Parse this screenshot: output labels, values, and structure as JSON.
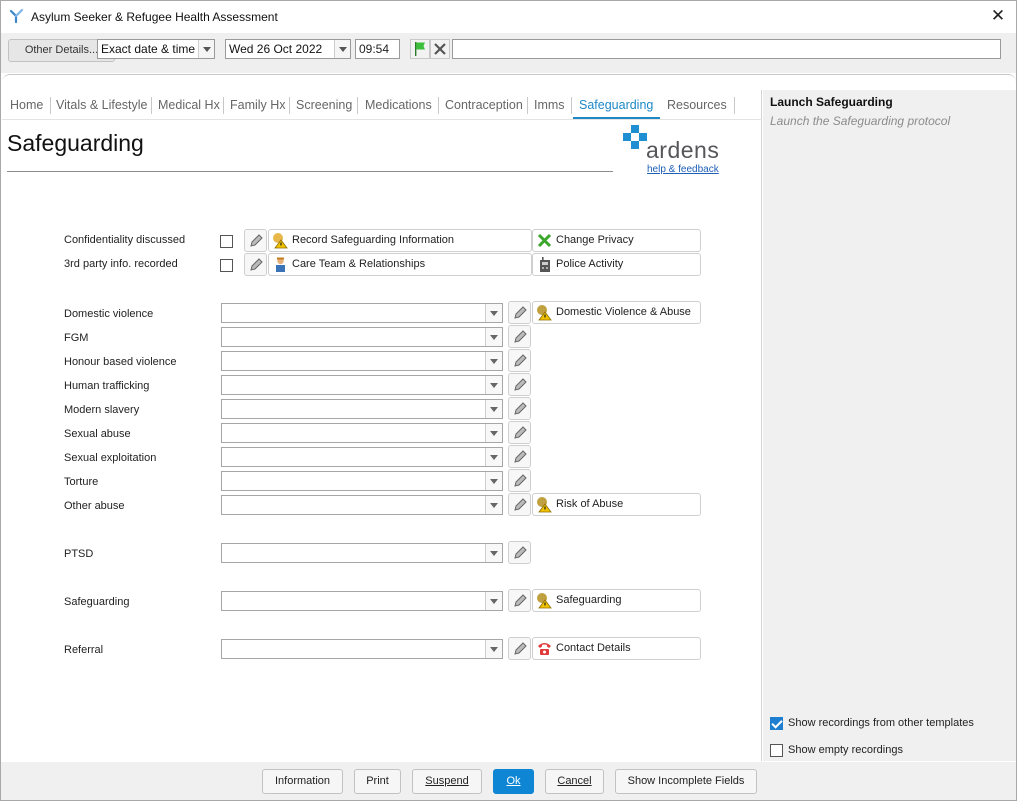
{
  "window": {
    "title": "Asylum Seeker & Refugee Health Assessment"
  },
  "toolbar": {
    "other_details_label": "Other Details...",
    "date_mode": "Exact date & time",
    "date_value": "Wed 26 Oct 2022",
    "time_value": "09:54",
    "free_text": ""
  },
  "tabs": [
    "Home",
    "Vitals & Lifestyle",
    "Medical Hx",
    "Family Hx",
    "Screening",
    "Medications",
    "Contraception",
    "Imms",
    "Safeguarding",
    "Resources"
  ],
  "active_tab": "Safeguarding",
  "page": {
    "title": "Safeguarding",
    "logo_text": "ardens",
    "help_link": "help & feedback"
  },
  "checks": [
    {
      "label": "Confidentiality discussed",
      "checked": false,
      "action": "Record Safeguarding Information",
      "action_icon": "safeguarding-warning-icon",
      "action2": "Change Privacy",
      "action2_icon": "green-x-icon"
    },
    {
      "label": "3rd party info. recorded",
      "checked": false,
      "action": "Care Team & Relationships",
      "action_icon": "person-icon",
      "action2": "Police Activity",
      "action2_icon": "police-radio-icon"
    }
  ],
  "combos": [
    {
      "label": "Domestic violence",
      "value": "",
      "action": "Domestic Violence & Abuse",
      "action_icon": "safeguarding-warning-icon"
    },
    {
      "label": "FGM",
      "value": ""
    },
    {
      "label": "Honour based violence",
      "value": ""
    },
    {
      "label": "Human trafficking",
      "value": ""
    },
    {
      "label": "Modern slavery",
      "value": ""
    },
    {
      "label": "Sexual abuse",
      "value": ""
    },
    {
      "label": "Sexual exploitation",
      "value": ""
    },
    {
      "label": "Torture",
      "value": ""
    },
    {
      "label": "Other abuse",
      "value": "",
      "action": "Risk of Abuse",
      "action_icon": "safeguarding-warning-icon"
    },
    {
      "label": "PTSD",
      "value": ""
    },
    {
      "label": "Safeguarding",
      "value": "",
      "action": "Safeguarding",
      "action_icon": "safeguarding-warning-icon"
    },
    {
      "label": "Referral",
      "value": "",
      "action": "Contact Details",
      "action_icon": "telephone-icon"
    }
  ],
  "right_panel": {
    "title": "Launch Safeguarding",
    "subtitle": "Launch the Safeguarding protocol",
    "show_other_templates": {
      "label": "Show recordings from other templates",
      "checked": true
    },
    "show_empty": {
      "label": "Show empty recordings",
      "checked": false
    }
  },
  "bottom_buttons": [
    "Information",
    "Print",
    "Suspend",
    "Ok",
    "Cancel",
    "Show Incomplete Fields"
  ],
  "colors": {
    "accent": "#1e88c7",
    "primary_button": "#0e86d4",
    "logo_blue": "#1e8fd2"
  }
}
